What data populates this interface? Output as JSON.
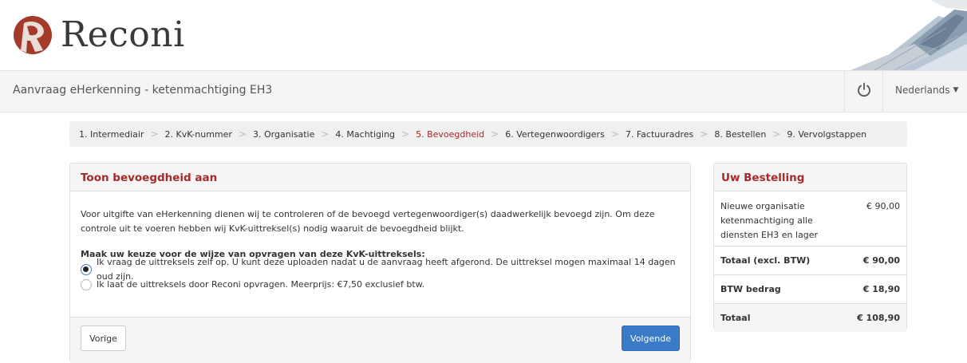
{
  "brand": {
    "name": "Reconi",
    "color": "#a52a2a",
    "logo_icon": "reconi-logo-icon"
  },
  "navbar": {
    "title": "Aanvraag eHerkenning - ketenmachtiging EH3",
    "power_icon": "power-icon",
    "language": "Nederlands"
  },
  "steps": [
    {
      "label": "1. Intermediair"
    },
    {
      "label": "2. KvK-nummer"
    },
    {
      "label": "3. Organisatie"
    },
    {
      "label": "4. Machtiging"
    },
    {
      "label": "5. Bevoegdheid",
      "active": true
    },
    {
      "label": "6. Vertegenwoordigers"
    },
    {
      "label": "7. Factuuradres"
    },
    {
      "label": "8. Bestellen"
    },
    {
      "label": "9. Vervolgstappen"
    }
  ],
  "main": {
    "heading": "Toon bevoegdheid aan",
    "intro": "Voor uitgifte van eHerkenning dienen wij te controleren of de bevoegd vertegenwoordiger(s) daadwerkelijk bevoegd zijn. Om deze controle uit te voeren hebben wij KvK-uittreksel(s) nodig waaruit de bevoegdheid blijkt.",
    "question": "Maak uw keuze voor de wijze van opvragen van deze KvK-uittreksels:",
    "options": [
      {
        "label": "Ik vraag de uittreksels zelf op. U kunt deze uploaden nadat u de aanvraag heeft afgerond. De uittreksel mogen maximaal 14 dagen oud zijn.",
        "checked": true
      },
      {
        "label": "Ik laat de uittreksels door Reconi opvragen. Meerprijs: €7,50 exclusief btw.",
        "checked": false
      }
    ],
    "prev_button": "Vorige",
    "next_button": "Volgende"
  },
  "order": {
    "heading": "Uw Bestelling",
    "item_description": "Nieuwe organisatie ketenmachtiging alle diensten EH3 en lager",
    "item_price": "€ 90,00",
    "subtotal_label": "Totaal (excl. BTW)",
    "subtotal_value": "€ 90,00",
    "vat_label": "BTW bedrag",
    "vat_value": "€ 18,90",
    "total_label": "Totaal",
    "total_value": "€ 108,90"
  }
}
